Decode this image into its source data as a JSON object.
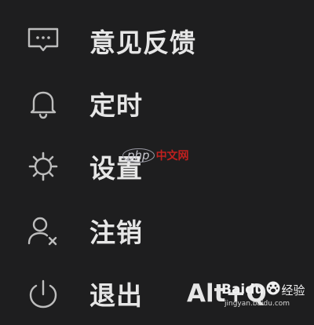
{
  "menu": {
    "items": [
      {
        "id": "feedback",
        "icon": "message-icon",
        "label": "意见反馈",
        "shortcut": ""
      },
      {
        "id": "timer",
        "icon": "bell-icon",
        "label": "定时",
        "shortcut": ""
      },
      {
        "id": "settings",
        "icon": "gear-icon",
        "label": "设置",
        "shortcut": ""
      },
      {
        "id": "logout",
        "icon": "user-remove-icon",
        "label": "注销",
        "shortcut": ""
      },
      {
        "id": "exit",
        "icon": "power-icon",
        "label": "退出",
        "shortcut": "Alt+Q"
      }
    ]
  },
  "watermarks": {
    "php_logo": "php",
    "php_text": "中文网",
    "baidu_name": "Baidu",
    "baidu_jingyan": "经验",
    "baidu_url": "jingyan.baidu.com"
  },
  "colors": {
    "background": "#1e1e1f",
    "text": "#e6e6e6",
    "icon": "#bdbdbd"
  }
}
